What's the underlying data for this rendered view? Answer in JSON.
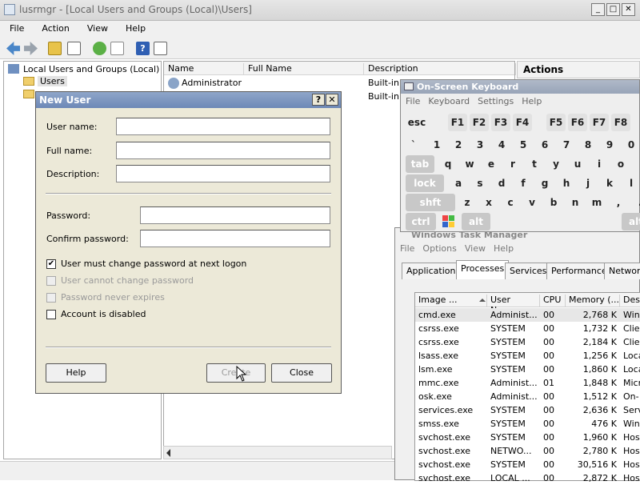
{
  "main_window": {
    "title": "lusrmgr - [Local Users and Groups (Local)\\Users]",
    "controls": {
      "minimize": "_",
      "maximize": "□",
      "close": "✕"
    },
    "menu": [
      "File",
      "Action",
      "View",
      "Help"
    ],
    "tree": {
      "root": "Local Users and Groups (Local)",
      "items": [
        "Users",
        ""
      ]
    },
    "list": {
      "columns": [
        "Name",
        "Full Name",
        "Description"
      ],
      "rows": [
        {
          "name": "Administrator",
          "full_name": "",
          "description": "Built-in a"
        },
        {
          "name": "",
          "full_name": "",
          "description": "Built-in a"
        }
      ]
    },
    "actions_header": "Actions"
  },
  "new_user_dialog": {
    "title": "New User",
    "help_btn": "?",
    "close_btn": "✕",
    "labels": {
      "user_name": "User name:",
      "full_name": "Full name:",
      "description": "Description:",
      "password": "Password:",
      "confirm_password": "Confirm password:"
    },
    "values": {
      "user_name": "",
      "full_name": "",
      "description": "",
      "password": "",
      "confirm_password": ""
    },
    "checkboxes": [
      {
        "label": "User must change password at next logon",
        "checked": true,
        "enabled": true,
        "mark": "✔"
      },
      {
        "label": "User cannot change password",
        "checked": false,
        "enabled": false,
        "mark": ""
      },
      {
        "label": "Password never expires",
        "checked": false,
        "enabled": false,
        "mark": ""
      },
      {
        "label": "Account is disabled",
        "checked": false,
        "enabled": true,
        "mark": ""
      }
    ],
    "buttons": {
      "help": "Help",
      "create": "Create",
      "close": "Close"
    }
  },
  "osk": {
    "title": "On-Screen Keyboard",
    "menu": [
      "File",
      "Keyboard",
      "Settings",
      "Help"
    ],
    "rows": [
      [
        "esc",
        "F1",
        "F2",
        "F3",
        "F4",
        "F5",
        "F6",
        "F7",
        "F8"
      ],
      [
        "`",
        "1",
        "2",
        "3",
        "4",
        "5",
        "6",
        "7",
        "8",
        "9",
        "0"
      ],
      [
        "tab",
        "q",
        "w",
        "e",
        "r",
        "t",
        "y",
        "u",
        "i",
        "o"
      ],
      [
        "lock",
        "a",
        "s",
        "d",
        "f",
        "g",
        "h",
        "j",
        "k",
        "l"
      ],
      [
        "shft",
        "z",
        "x",
        "c",
        "v",
        "b",
        "n",
        "m",
        ",",
        "."
      ],
      [
        "ctrl",
        "alt",
        "alt"
      ]
    ]
  },
  "task_manager": {
    "title": "Windows Task Manager",
    "menu": [
      "File",
      "Options",
      "View",
      "Help"
    ],
    "tabs": [
      "Applications",
      "Processes",
      "Services",
      "Performance",
      "Network"
    ],
    "active_tab": "Processes",
    "columns": [
      "Image ...",
      "User Name",
      "CPU",
      "Memory (...",
      "Des"
    ],
    "rows": [
      [
        "cmd.exe",
        "Administ...",
        "00",
        "2,768 K",
        "Win"
      ],
      [
        "csrss.exe",
        "SYSTEM",
        "00",
        "1,732 K",
        "Clie"
      ],
      [
        "csrss.exe",
        "SYSTEM",
        "00",
        "2,184 K",
        "Clie"
      ],
      [
        "lsass.exe",
        "SYSTEM",
        "00",
        "1,256 K",
        "Loca"
      ],
      [
        "lsm.exe",
        "SYSTEM",
        "00",
        "1,860 K",
        "Loca"
      ],
      [
        "mmc.exe",
        "Administ...",
        "01",
        "1,848 K",
        "Micr"
      ],
      [
        "osk.exe",
        "Administ...",
        "00",
        "1,512 K",
        "On-"
      ],
      [
        "services.exe",
        "SYSTEM",
        "00",
        "2,636 K",
        "Serv"
      ],
      [
        "smss.exe",
        "SYSTEM",
        "00",
        "476 K",
        "Win"
      ],
      [
        "svchost.exe",
        "SYSTEM",
        "00",
        "1,960 K",
        "Hos"
      ],
      [
        "svchost.exe",
        "NETWO...",
        "00",
        "2,780 K",
        "Hos"
      ],
      [
        "svchost.exe",
        "SYSTEM",
        "00",
        "30,516 K",
        "Hos"
      ],
      [
        "svchost.exe",
        "LOCAL ...",
        "00",
        "2,872 K",
        "Hos"
      ]
    ]
  }
}
